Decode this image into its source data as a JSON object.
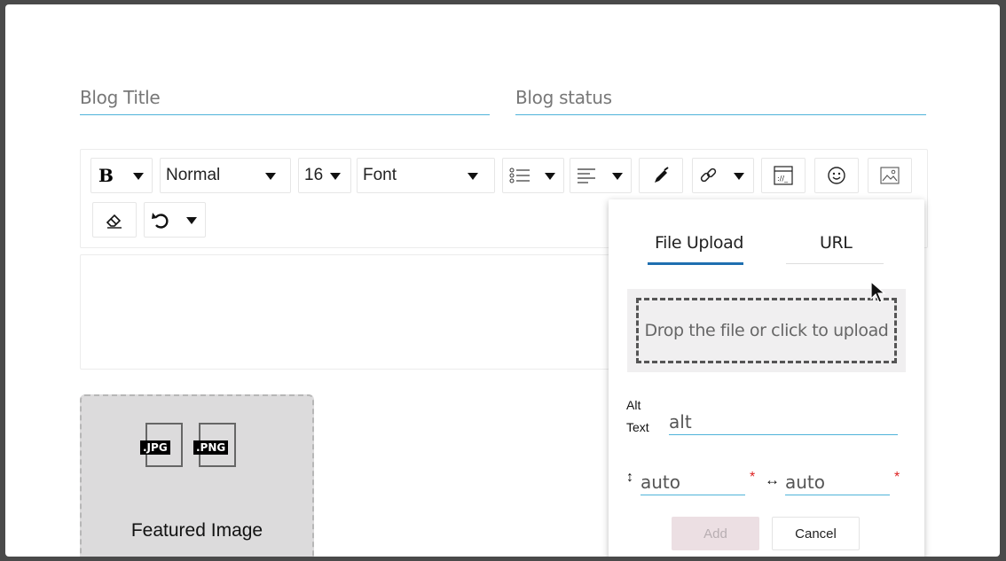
{
  "form": {
    "blog_title_placeholder": "Blog Title",
    "blog_status_placeholder": "Blog status"
  },
  "toolbar": {
    "bold_label": "B",
    "block_type_label": "Normal",
    "font_size_label": "16",
    "font_family_label": "Font",
    "icons": [
      "bold-icon",
      "list-icon",
      "align-icon",
      "color-picker-icon",
      "link-icon",
      "embed-icon",
      "emoji-icon",
      "image-icon",
      "eraser-icon",
      "undo-icon"
    ]
  },
  "featured": {
    "caption": "Featured Image",
    "jpg_label": ".JPG",
    "png_label": ".PNG"
  },
  "image_popup": {
    "tab_file_upload": "File Upload",
    "tab_url": "URL",
    "dropzone_text": "Drop the file or click to upload",
    "alt_label_line1": "Alt",
    "alt_label_line2": "Text",
    "alt_value": "alt",
    "height_icon_glyph": "↕",
    "height_value": "auto",
    "width_icon_glyph": "↔",
    "width_value": "auto",
    "required_mark": "*",
    "add_label": "Add",
    "cancel_label": "Cancel",
    "accent_color": "#1f6fb0"
  }
}
